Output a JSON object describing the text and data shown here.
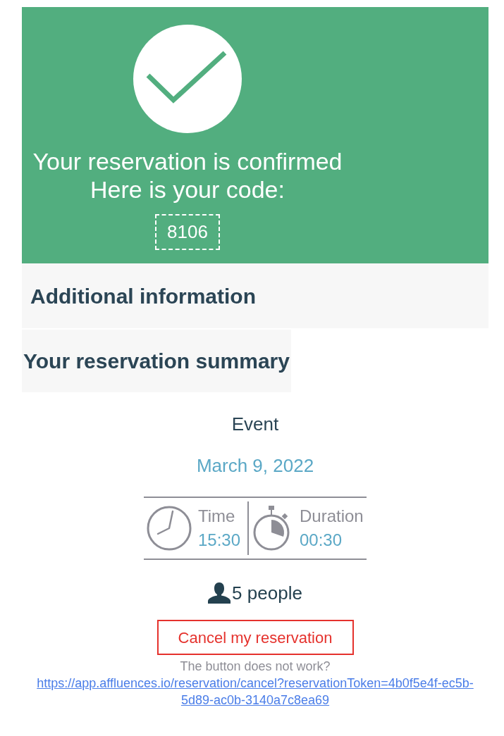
{
  "confirmation": {
    "title": "Your reservation is confirmed",
    "subtitle": "Here is your code:",
    "code": "8106"
  },
  "additional_information": {
    "heading": "Additional information"
  },
  "summary": {
    "heading": "Your reservation summary",
    "event": "Event",
    "date": "March 9, 2022",
    "details": [
      {
        "kind": "time",
        "label": "Time",
        "value": "15:30"
      },
      {
        "kind": "duration",
        "label": "Duration",
        "value": "00:30"
      }
    ],
    "people": "5 people"
  },
  "cancel": {
    "button": "Cancel my reservation",
    "hint": "The button does not work?",
    "link": "https://app.affluences.io/reservation/cancel?reservationToken=4b0f5e4f-ec5b-5d89-ac0b-3140a7c8ea69"
  }
}
